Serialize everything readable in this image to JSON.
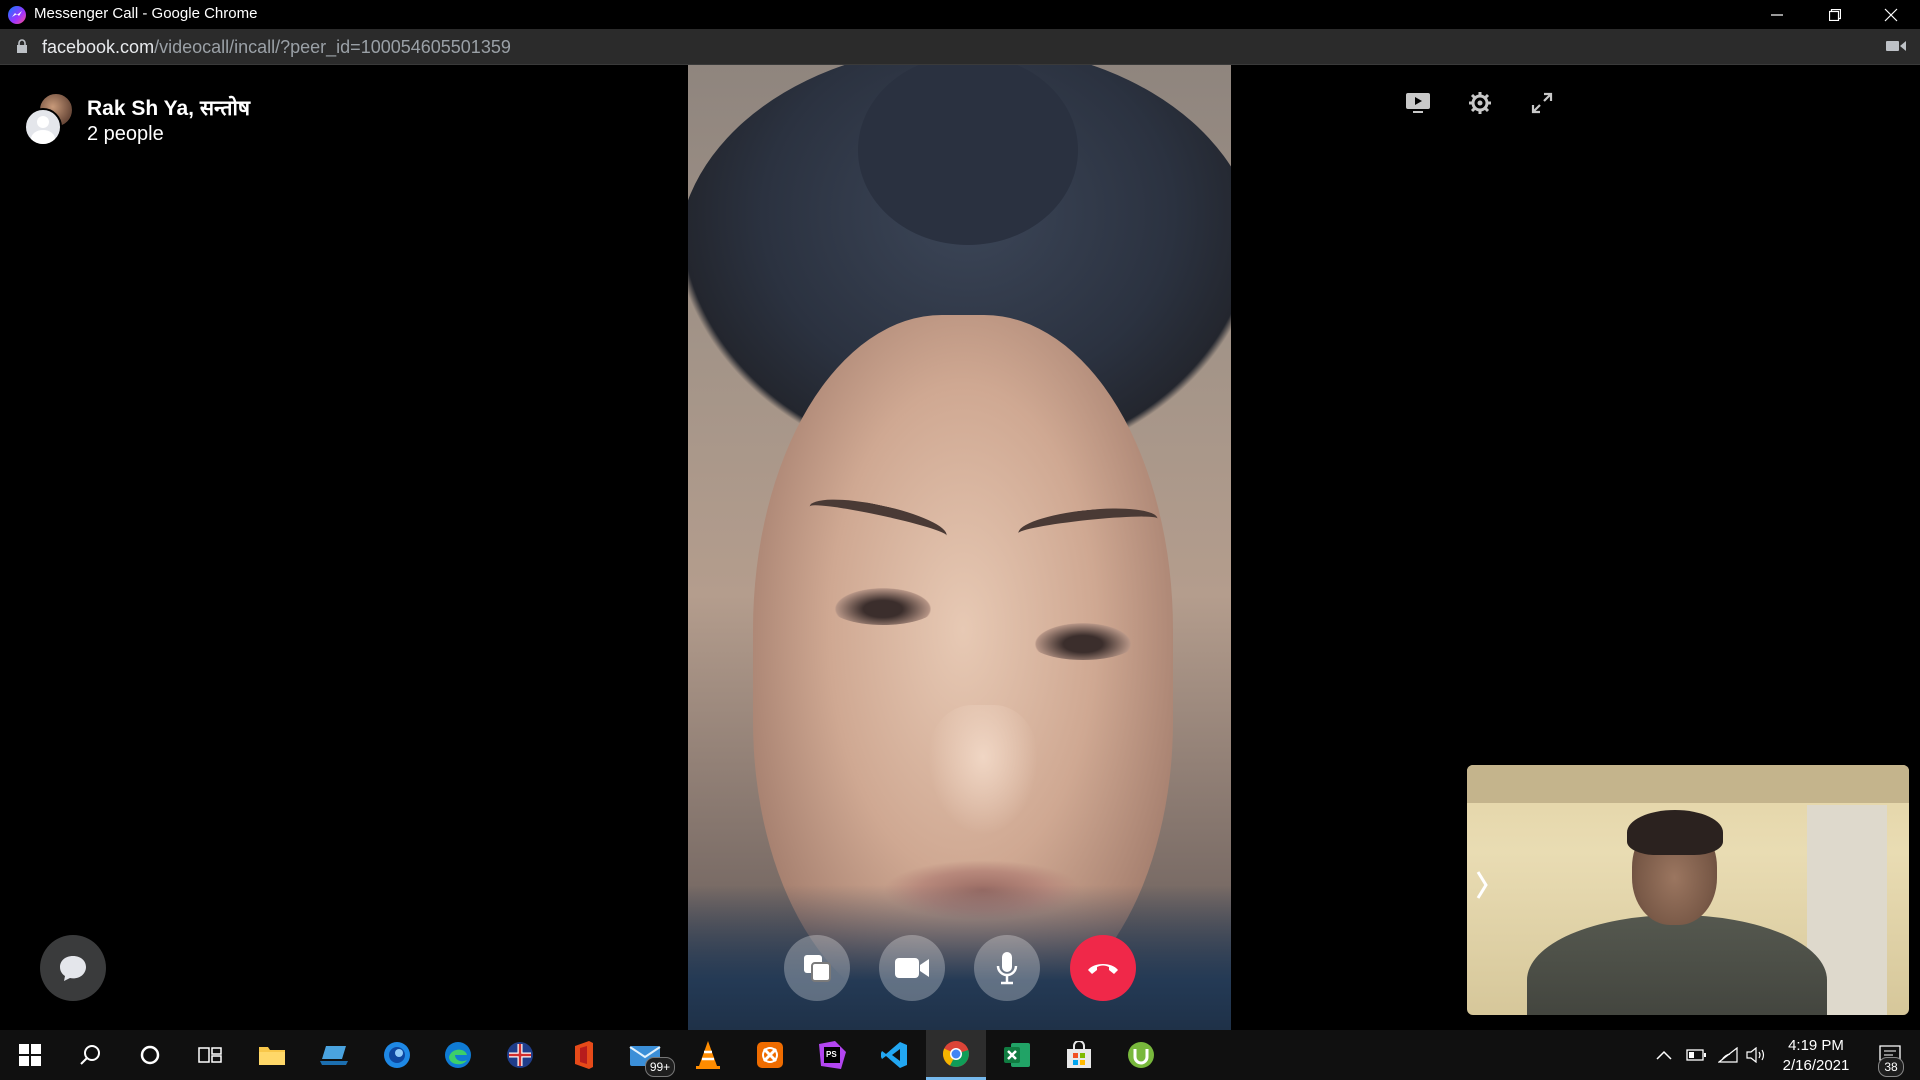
{
  "window": {
    "title": "Messenger Call - Google Chrome"
  },
  "address_bar": {
    "url_host": "facebook.com",
    "url_path": "/videocall/incall/?peer_id=100054605501359"
  },
  "call": {
    "name": "Rak Sh Ya, सन्तोष",
    "participants": "2 people"
  },
  "colors": {
    "end_call": "#f02849",
    "messenger_accent": "#0a7cff"
  },
  "taskbar": {
    "items": [
      {
        "name": "start",
        "icon": "windows-icon"
      },
      {
        "name": "search",
        "icon": "search-icon"
      },
      {
        "name": "cortana",
        "icon": "cortana-icon"
      },
      {
        "name": "task-view",
        "icon": "task-view-icon"
      },
      {
        "name": "file-explorer",
        "icon": "folder-icon"
      },
      {
        "name": "app-laptop",
        "icon": "laptop-icon"
      },
      {
        "name": "app-blue",
        "icon": "blue-circle-app-icon"
      },
      {
        "name": "edge",
        "icon": "edge-icon"
      },
      {
        "name": "app-flag",
        "icon": "flag-app-icon"
      },
      {
        "name": "office",
        "icon": "office-icon"
      },
      {
        "name": "mail",
        "icon": "mail-icon",
        "badge": "99+"
      },
      {
        "name": "vlc",
        "icon": "vlc-cone-icon"
      },
      {
        "name": "app-orange",
        "icon": "orange-app-icon"
      },
      {
        "name": "phpstorm",
        "icon": "phpstorm-icon"
      },
      {
        "name": "vscode",
        "icon": "vscode-icon"
      },
      {
        "name": "chrome",
        "icon": "chrome-icon",
        "active": true
      },
      {
        "name": "excel",
        "icon": "excel-icon"
      },
      {
        "name": "store",
        "icon": "store-icon"
      },
      {
        "name": "utorrent",
        "icon": "utorrent-icon"
      }
    ],
    "clock": {
      "time": "4:19 PM",
      "date": "2/16/2021"
    },
    "notification_count": "38"
  }
}
